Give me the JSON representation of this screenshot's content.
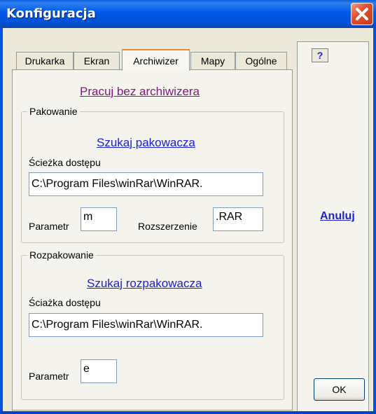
{
  "window": {
    "title": "Konfiguracja"
  },
  "tabs": [
    {
      "label": "Drukarka",
      "active": false
    },
    {
      "label": "Ekran",
      "active": false
    },
    {
      "label": "Archiwizer",
      "active": true
    },
    {
      "label": "Mapy",
      "active": false
    },
    {
      "label": "Ogólne",
      "active": false
    }
  ],
  "archiwizer": {
    "no_archiver_link": "Pracuj bez archiwizera",
    "packing": {
      "legend": "Pakowanie",
      "find_link": "Szukaj pakowacza",
      "path_label": "Ścieżka dostępu",
      "path_value": "C:\\Program Files\\winRar\\WinRAR.",
      "param_label": "Parametr",
      "param_value": "m",
      "ext_label": "Rozszerzenie",
      "ext_value": ".RAR"
    },
    "unpacking": {
      "legend": "Rozpakowanie",
      "find_link": "Szukaj rozpakowacza",
      "path_label": "Ściażka dostępu",
      "path_value": "C:\\Program Files\\winRar\\WinRAR.",
      "param_label": "Parametr",
      "param_value": "e"
    }
  },
  "side": {
    "help_label": "?",
    "cancel_label": "Anuluj",
    "ok_label": "OK"
  },
  "colors": {
    "titlebar": "#0058e6",
    "link": "#1c20d8",
    "visited_link": "#7b1a7a",
    "active_tab_accent": "#e68b2c",
    "close_button": "#e0512e"
  },
  "icons": {
    "close": "close-x-icon"
  }
}
